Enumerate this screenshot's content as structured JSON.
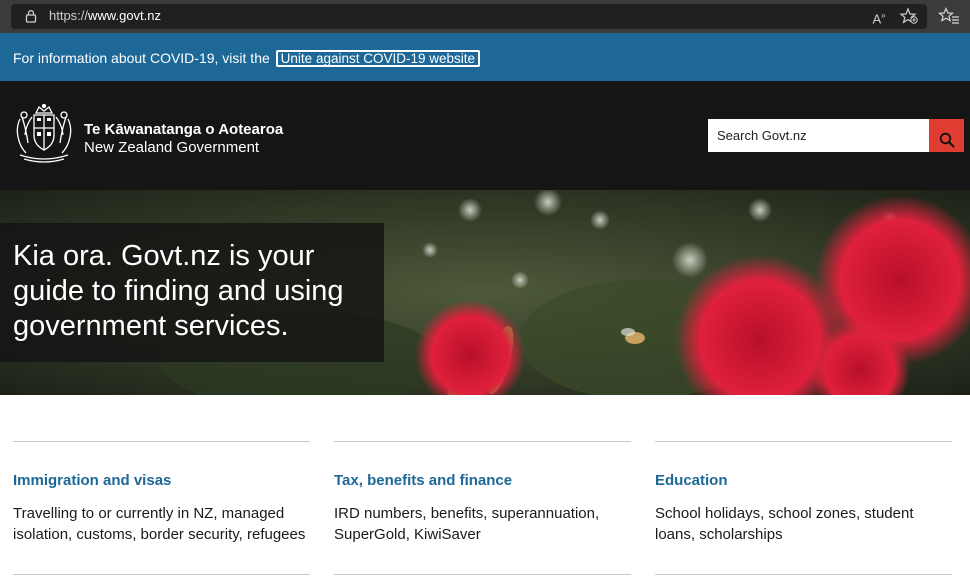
{
  "browser": {
    "url_scheme": "https://",
    "url_host": "www.govt.nz",
    "read_aloud_icon": "read-aloud-icon",
    "favorite_icon": "add-favorite-icon",
    "favorites_bar_icon": "favorites-icon"
  },
  "banner": {
    "text": "For information about COVID-19, visit the",
    "link_label": "Unite against COVID-19 website",
    "background": "#1d6897"
  },
  "header": {
    "brand_maori": "Te Kāwanatanga o Aotearoa",
    "brand_english": "New Zealand Government",
    "search_placeholder": "Search Govt.nz",
    "search_button_color": "#e03c31",
    "background": "#151515"
  },
  "hero": {
    "title": "Kia ora. Govt.nz is your guide to finding and using government services."
  },
  "cards": [
    {
      "title": "Immigration and visas",
      "description": "Travelling to or currently in NZ, managed isolation, customs, border security, refugees"
    },
    {
      "title": "Tax, benefits and finance",
      "description": "IRD numbers, benefits, superannuation, SuperGold, KiwiSaver"
    },
    {
      "title": "Education",
      "description": "School holidays, school zones, student loans, scholarships"
    }
  ]
}
